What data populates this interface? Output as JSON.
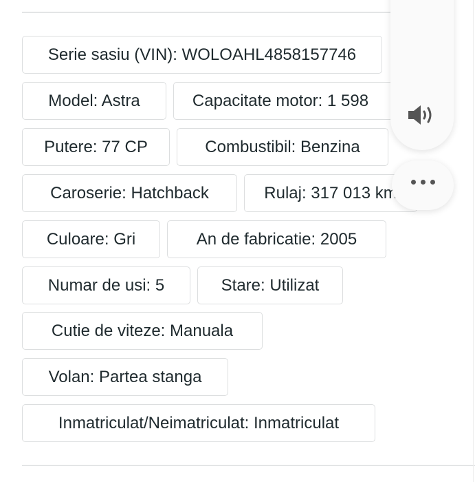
{
  "attributes": [
    {
      "label": "Serie sasiu (VIN): WOLOAHL4858157746"
    },
    {
      "label": "Model: Astra"
    },
    {
      "label": "Capacitate motor: 1 598"
    },
    {
      "label": "Putere: 77 CP"
    },
    {
      "label": "Combustibil: Benzina"
    },
    {
      "label": "Caroserie: Hatchback"
    },
    {
      "label": "Rulaj: 317 013 km"
    },
    {
      "label": "Culoare: Gri"
    },
    {
      "label": "An de fabricatie: 2005"
    },
    {
      "label": "Numar de usi: 5"
    },
    {
      "label": "Stare: Utilizat"
    },
    {
      "label": "Cutie de viteze: Manuala"
    },
    {
      "label": "Volan: Partea stanga"
    },
    {
      "label": "Inmatriculat/Neimatriculat: Inmatriculat"
    }
  ],
  "floating": {
    "speaker_icon": "speaker-icon",
    "more_icon": "more-dots-icon"
  }
}
